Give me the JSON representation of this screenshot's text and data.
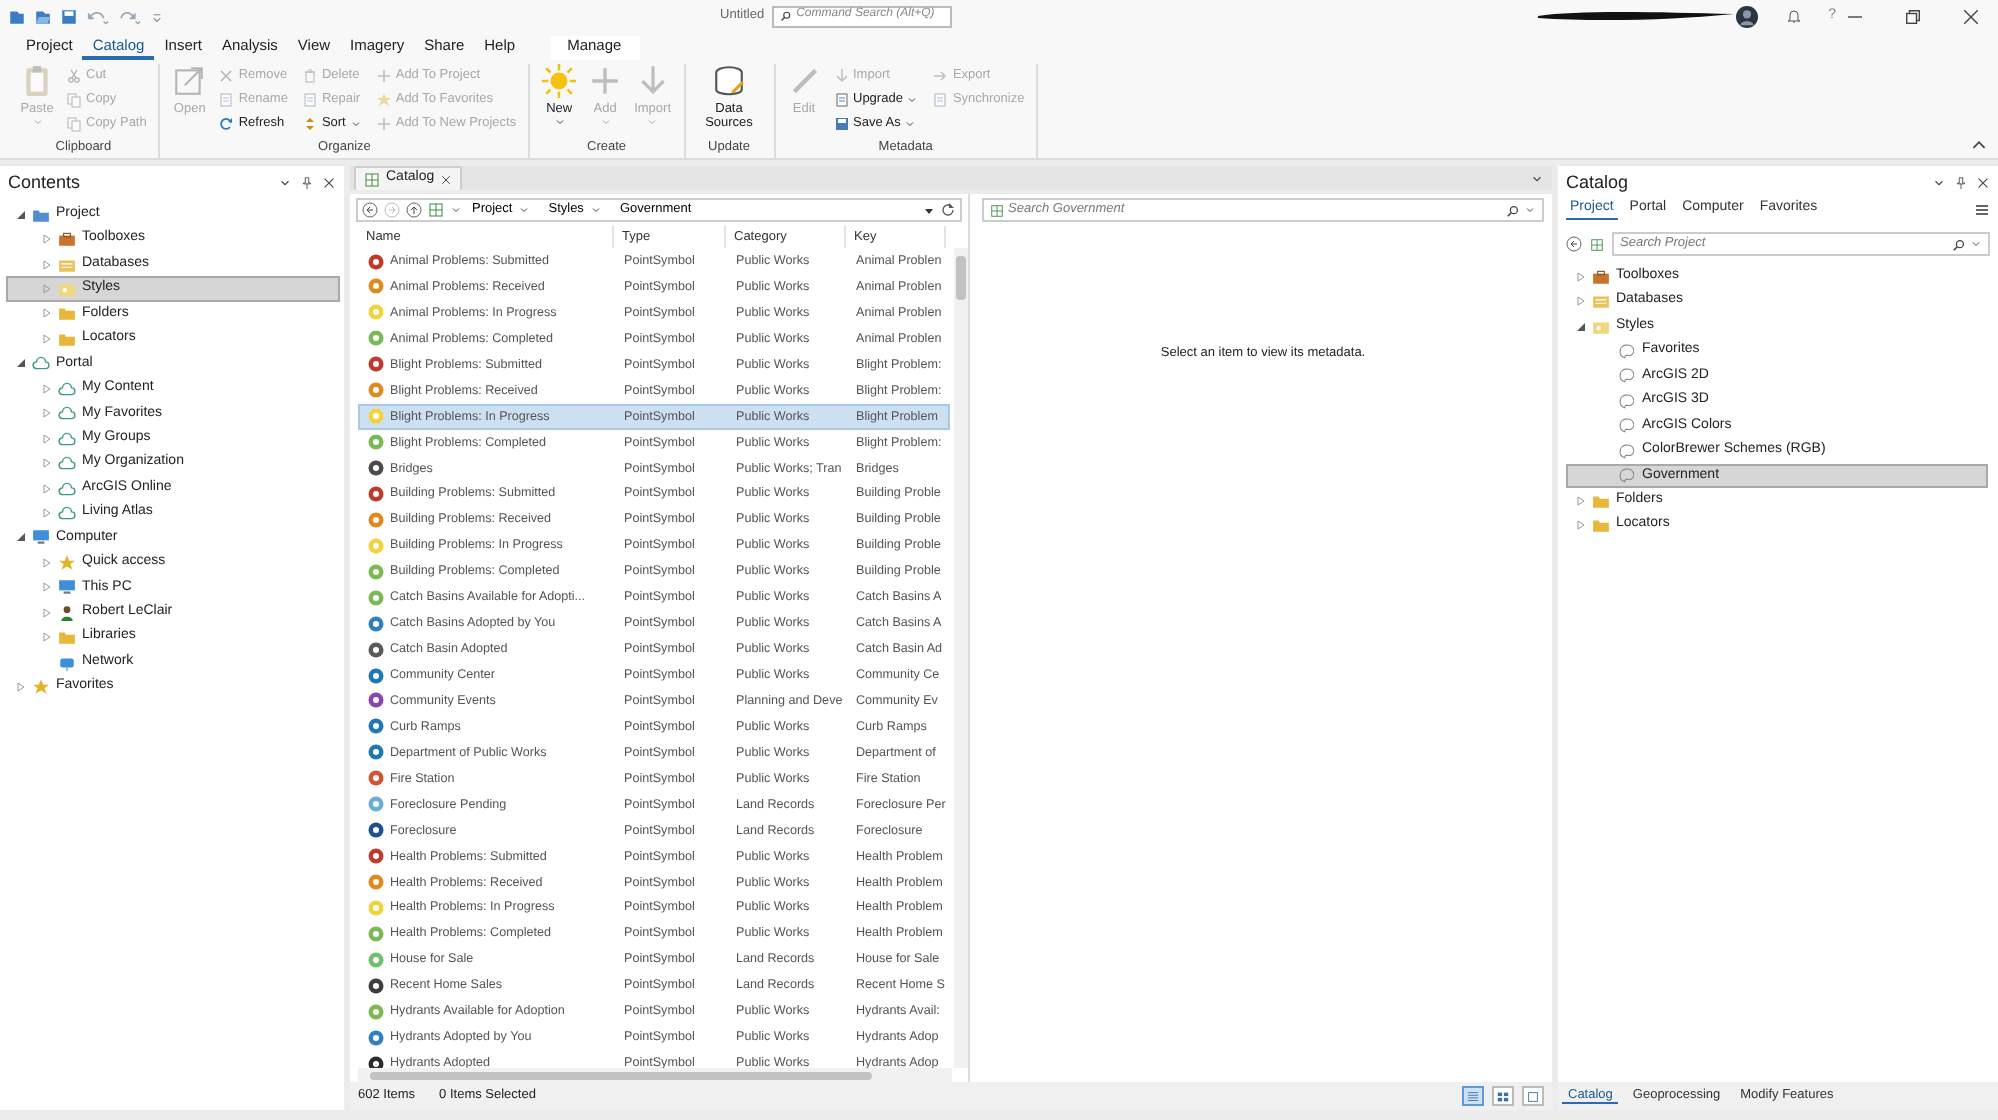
{
  "title_bar": {
    "title": "Untitled",
    "search": {
      "placeholder": "Command Search (Alt+Q)"
    },
    "help_glyph": "?"
  },
  "ribbon": {
    "tabs": [
      {
        "label": "Project",
        "selected": false,
        "contextual": false
      },
      {
        "label": "Catalog",
        "selected": true,
        "contextual": false
      },
      {
        "label": "Insert",
        "selected": false,
        "contextual": false
      },
      {
        "label": "Analysis",
        "selected": false,
        "contextual": false
      },
      {
        "label": "View",
        "selected": false,
        "contextual": false
      },
      {
        "label": "Imagery",
        "selected": false,
        "contextual": false
      },
      {
        "label": "Share",
        "selected": false,
        "contextual": false
      },
      {
        "label": "Help",
        "selected": false,
        "contextual": false
      },
      {
        "label": "Manage",
        "selected": false,
        "contextual": true
      }
    ],
    "groups": [
      {
        "label": "Clipboard",
        "buttons": [
          {
            "label": "Paste",
            "kind": "large",
            "disabled": true,
            "dropdown": true
          },
          {
            "label": "Cut",
            "kind": "small",
            "disabled": true,
            "dropdown": false
          },
          {
            "label": "Copy",
            "kind": "small",
            "disabled": true,
            "dropdown": false
          },
          {
            "label": "Copy Path",
            "kind": "small",
            "disabled": true,
            "dropdown": false
          }
        ]
      },
      {
        "label": "Organize",
        "buttons": [
          {
            "label": "Open",
            "kind": "large",
            "disabled": true,
            "dropdown": false
          },
          {
            "label": "Remove",
            "kind": "small",
            "disabled": true,
            "dropdown": false
          },
          {
            "label": "Rename",
            "kind": "small",
            "disabled": true,
            "dropdown": false
          },
          {
            "label": "Refresh",
            "kind": "small",
            "disabled": false,
            "dropdown": false
          },
          {
            "label": "Delete",
            "kind": "small",
            "disabled": true,
            "dropdown": false
          },
          {
            "label": "Repair",
            "kind": "small",
            "disabled": true,
            "dropdown": false
          },
          {
            "label": "Sort",
            "kind": "small",
            "disabled": false,
            "dropdown": true
          },
          {
            "label": "Add To Project",
            "kind": "small",
            "disabled": true,
            "dropdown": false
          },
          {
            "label": "Add To Favorites",
            "kind": "small",
            "disabled": true,
            "dropdown": false
          },
          {
            "label": "Add To New Projects",
            "kind": "small",
            "disabled": true,
            "dropdown": false
          }
        ]
      },
      {
        "label": "Create",
        "buttons": [
          {
            "label": "New",
            "kind": "large",
            "disabled": false,
            "dropdown": true
          },
          {
            "label": "Add",
            "kind": "large",
            "disabled": true,
            "dropdown": true
          },
          {
            "label": "Import",
            "kind": "large",
            "disabled": true,
            "dropdown": true
          }
        ]
      },
      {
        "label": "Update",
        "buttons": [
          {
            "label": "Data Sources",
            "kind": "large",
            "disabled": false,
            "dropdown": false
          }
        ]
      },
      {
        "label": "Metadata",
        "buttons": [
          {
            "label": "Edit",
            "kind": "large",
            "disabled": true,
            "dropdown": false
          },
          {
            "label": "Import",
            "kind": "small",
            "disabled": true,
            "dropdown": false
          },
          {
            "label": "Upgrade",
            "kind": "small",
            "disabled": false,
            "dropdown": true
          },
          {
            "label": "Save As",
            "kind": "small",
            "disabled": false,
            "dropdown": true
          },
          {
            "label": "Export",
            "kind": "small",
            "disabled": true,
            "dropdown": false
          },
          {
            "label": "Synchronize",
            "kind": "small",
            "disabled": true,
            "dropdown": false
          }
        ]
      }
    ]
  },
  "contents_pane": {
    "title": "Contents",
    "tree": [
      {
        "label": "Project",
        "kind": "project",
        "expanded": true,
        "selected": false,
        "children": [
          {
            "label": "Toolboxes",
            "kind": "toolbox",
            "expanded": false,
            "selected": false
          },
          {
            "label": "Databases",
            "kind": "database",
            "expanded": false,
            "selected": false
          },
          {
            "label": "Styles",
            "kind": "style",
            "expanded": false,
            "selected": true
          },
          {
            "label": "Folders",
            "kind": "folder",
            "expanded": false,
            "selected": false
          },
          {
            "label": "Locators",
            "kind": "folder",
            "expanded": false,
            "selected": false
          }
        ]
      },
      {
        "label": "Portal",
        "kind": "cloud",
        "expanded": true,
        "selected": false,
        "children": [
          {
            "label": "My Content",
            "kind": "cloud",
            "expanded": false,
            "selected": false
          },
          {
            "label": "My Favorites",
            "kind": "cloud",
            "expanded": false,
            "selected": false
          },
          {
            "label": "My Groups",
            "kind": "cloud",
            "expanded": false,
            "selected": false
          },
          {
            "label": "My Organization",
            "kind": "cloud",
            "expanded": false,
            "selected": false
          },
          {
            "label": "ArcGIS Online",
            "kind": "cloud",
            "expanded": false,
            "selected": false
          },
          {
            "label": "Living Atlas",
            "kind": "cloud",
            "expanded": false,
            "selected": false
          }
        ]
      },
      {
        "label": "Computer",
        "kind": "computer",
        "expanded": true,
        "selected": false,
        "children": [
          {
            "label": "Quick access",
            "kind": "star",
            "expanded": false,
            "selected": false
          },
          {
            "label": "This PC",
            "kind": "computer",
            "expanded": false,
            "selected": false
          },
          {
            "label": "Robert LeClair",
            "kind": "user",
            "expanded": false,
            "selected": false
          },
          {
            "label": "Libraries",
            "kind": "folder",
            "expanded": false,
            "selected": false
          },
          {
            "label": "Network",
            "kind": "network",
            "selected": false
          }
        ]
      },
      {
        "label": "Favorites",
        "kind": "star",
        "expanded": false,
        "selected": false
      }
    ]
  },
  "catalog_view": {
    "tab": {
      "label": "Catalog"
    },
    "breadcrumbs": [
      "Project",
      "Styles",
      "Government"
    ],
    "search": {
      "placeholder": "Search Government"
    },
    "metadata_message": "Select an item to view its metadata.",
    "table": {
      "columns": [
        "Name",
        "Type",
        "Category",
        "Key"
      ],
      "rows": [
        {
          "name": "Animal Problems: Submitted",
          "type": "PointSymbol",
          "category": "Public Works",
          "key": "Animal Problen",
          "color": "#c0392b",
          "selected": false
        },
        {
          "name": "Animal Problems: Received",
          "type": "PointSymbol",
          "category": "Public Works",
          "key": "Animal Problen",
          "color": "#e08a1e",
          "selected": false
        },
        {
          "name": "Animal Problems: In Progress",
          "type": "PointSymbol",
          "category": "Public Works",
          "key": "Animal Problen",
          "color": "#f2d33a",
          "selected": false
        },
        {
          "name": "Animal Problems: Completed",
          "type": "PointSymbol",
          "category": "Public Works",
          "key": "Animal Problen",
          "color": "#7cb956",
          "selected": false
        },
        {
          "name": "Blight Problems: Submitted",
          "type": "PointSymbol",
          "category": "Public Works",
          "key": "Blight Problem:",
          "color": "#c0392b",
          "selected": false
        },
        {
          "name": "Blight Problems: Received",
          "type": "PointSymbol",
          "category": "Public Works",
          "key": "Blight Problem:",
          "color": "#e08a1e",
          "selected": false
        },
        {
          "name": "Blight Problems: In Progress",
          "type": "PointSymbol",
          "category": "Public Works",
          "key": "Blight Problem",
          "color": "#f2d33a",
          "selected": true
        },
        {
          "name": "Blight Problems: Completed",
          "type": "PointSymbol",
          "category": "Public Works",
          "key": "Blight Problem:",
          "color": "#7cb956",
          "selected": false
        },
        {
          "name": "Bridges",
          "type": "PointSymbol",
          "category": "Public Works; Tran",
          "key": "Bridges",
          "color": "#4a4a4a",
          "selected": false
        },
        {
          "name": "Building Problems: Submitted",
          "type": "PointSymbol",
          "category": "Public Works",
          "key": "Building Proble",
          "color": "#c0392b",
          "selected": false
        },
        {
          "name": "Building Problems: Received",
          "type": "PointSymbol",
          "category": "Public Works",
          "key": "Building Proble",
          "color": "#e08a1e",
          "selected": false
        },
        {
          "name": "Building Problems: In Progress",
          "type": "PointSymbol",
          "category": "Public Works",
          "key": "Building Proble",
          "color": "#f2d33a",
          "selected": false
        },
        {
          "name": "Building Problems: Completed",
          "type": "PointSymbol",
          "category": "Public Works",
          "key": "Building Proble",
          "color": "#7cb956",
          "selected": false
        },
        {
          "name": "Catch Basins Available for Adopti...",
          "type": "PointSymbol",
          "category": "Public Works",
          "key": "Catch Basins A",
          "color": "#7cb956",
          "selected": false
        },
        {
          "name": "Catch Basins Adopted by You",
          "type": "PointSymbol",
          "category": "Public Works",
          "key": "Catch Basins A",
          "color": "#2f7fc1",
          "selected": false
        },
        {
          "name": "Catch Basin Adopted",
          "type": "PointSymbol",
          "category": "Public Works",
          "key": "Catch Basin Ad",
          "color": "#5a5a5a",
          "selected": false
        },
        {
          "name": "Community Center",
          "type": "PointSymbol",
          "category": "Public Works",
          "key": "Community Ce",
          "color": "#1f78b4",
          "selected": false
        },
        {
          "name": "Community Events",
          "type": "PointSymbol",
          "category": "Planning and Deve",
          "key": "Community Ev",
          "color": "#8e44ad",
          "selected": false
        },
        {
          "name": "Curb Ramps",
          "type": "PointSymbol",
          "category": "Public Works",
          "key": "Curb Ramps",
          "color": "#1f78b4",
          "selected": false
        },
        {
          "name": "Department of Public Works",
          "type": "PointSymbol",
          "category": "Public Works",
          "key": "Department of",
          "color": "#1f78b4",
          "selected": false
        },
        {
          "name": "Fire Station",
          "type": "PointSymbol",
          "category": "Public Works",
          "key": "Fire Station",
          "color": "#d35435",
          "selected": false
        },
        {
          "name": "Foreclosure Pending",
          "type": "PointSymbol",
          "category": "Land Records",
          "key": "Foreclosure Per",
          "color": "#6aaed6",
          "selected": false
        },
        {
          "name": "Foreclosure",
          "type": "PointSymbol",
          "category": "Land Records",
          "key": "Foreclosure",
          "color": "#1d4f91",
          "selected": false
        },
        {
          "name": "Health Problems: Submitted",
          "type": "PointSymbol",
          "category": "Public Works",
          "key": "Health Problem",
          "color": "#c0392b",
          "selected": false
        },
        {
          "name": "Health Problems: Received",
          "type": "PointSymbol",
          "category": "Public Works",
          "key": "Health Problem",
          "color": "#e08a1e",
          "selected": false
        },
        {
          "name": "Health Problems: In Progress",
          "type": "PointSymbol",
          "category": "Public Works",
          "key": "Health Problem",
          "color": "#f2d33a",
          "selected": false
        },
        {
          "name": "Health Problems: Completed",
          "type": "PointSymbol",
          "category": "Public Works",
          "key": "Health Problem",
          "color": "#7cb956",
          "selected": false
        },
        {
          "name": "House for Sale",
          "type": "PointSymbol",
          "category": "Land Records",
          "key": "House for Sale",
          "color": "#6fbf73",
          "selected": false
        },
        {
          "name": "Recent Home Sales",
          "type": "PointSymbol",
          "category": "Land Records",
          "key": "Recent Home S",
          "color": "#3d3d3d",
          "selected": false
        },
        {
          "name": "Hydrants Available for Adoption",
          "type": "PointSymbol",
          "category": "Public Works",
          "key": "Hydrants Avail:",
          "color": "#7cb956",
          "selected": false
        },
        {
          "name": "Hydrants Adopted by You",
          "type": "PointSymbol",
          "category": "Public Works",
          "key": "Hydrants Adop",
          "color": "#2f7fc1",
          "selected": false
        },
        {
          "name": "Hydrants Adopted",
          "type": "PointSymbol",
          "category": "Public Works",
          "key": "Hydrants Adop",
          "color": "#2b2b2b",
          "selected": false
        }
      ]
    },
    "item_count": "602 Items",
    "selected_count": "0 Items Selected",
    "view_buttons": [
      {
        "selected": true
      },
      {
        "selected": false
      },
      {
        "selected": false
      }
    ]
  },
  "catalog_pane": {
    "title": "Catalog",
    "tabs": [
      {
        "label": "Project",
        "selected": true
      },
      {
        "label": "Portal",
        "selected": false
      },
      {
        "label": "Computer",
        "selected": false
      },
      {
        "label": "Favorites",
        "selected": false
      }
    ],
    "search": {
      "placeholder": "Search Project"
    },
    "tree": [
      {
        "label": "Toolboxes",
        "kind": "toolbox",
        "expanded": false,
        "selected": false
      },
      {
        "label": "Databases",
        "kind": "database",
        "expanded": false,
        "selected": false
      },
      {
        "label": "Styles",
        "kind": "style",
        "expanded": true,
        "selected": false,
        "children": [
          {
            "label": "Favorites",
            "kind": "stylefile",
            "selected": false
          },
          {
            "label": "ArcGIS 2D",
            "kind": "stylefile",
            "selected": false
          },
          {
            "label": "ArcGIS 3D",
            "kind": "stylefile",
            "selected": false
          },
          {
            "label": "ArcGIS Colors",
            "kind": "stylefile",
            "selected": false
          },
          {
            "label": "ColorBrewer Schemes (RGB)",
            "kind": "stylefile",
            "selected": false
          },
          {
            "label": "Government",
            "kind": "stylefile",
            "selected": true
          }
        ]
      },
      {
        "label": "Folders",
        "kind": "folder",
        "expanded": false,
        "selected": false
      },
      {
        "label": "Locators",
        "kind": "folder",
        "expanded": false,
        "selected": false
      }
    ]
  },
  "bottom_tabs": [
    {
      "label": "Catalog",
      "selected": true
    },
    {
      "label": "Geoprocessing",
      "selected": false
    },
    {
      "label": "Modify Features",
      "selected": false
    }
  ]
}
